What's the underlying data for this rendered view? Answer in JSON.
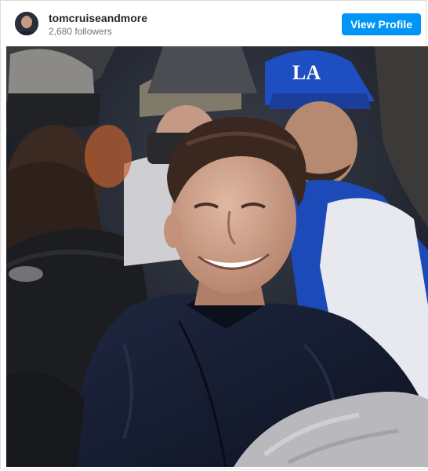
{
  "post": {
    "username": "tomcruiseandmore",
    "followers": "2,680 followers",
    "view_profile_label": "View Profile"
  },
  "photo": {
    "subject": "smiling man in navy puffer jacket at a stadium crowd",
    "cap_logo": "LA"
  },
  "colors": {
    "button": "#0095f6",
    "username": "#262626",
    "muted": "#737373",
    "border": "#dbdbdb"
  }
}
